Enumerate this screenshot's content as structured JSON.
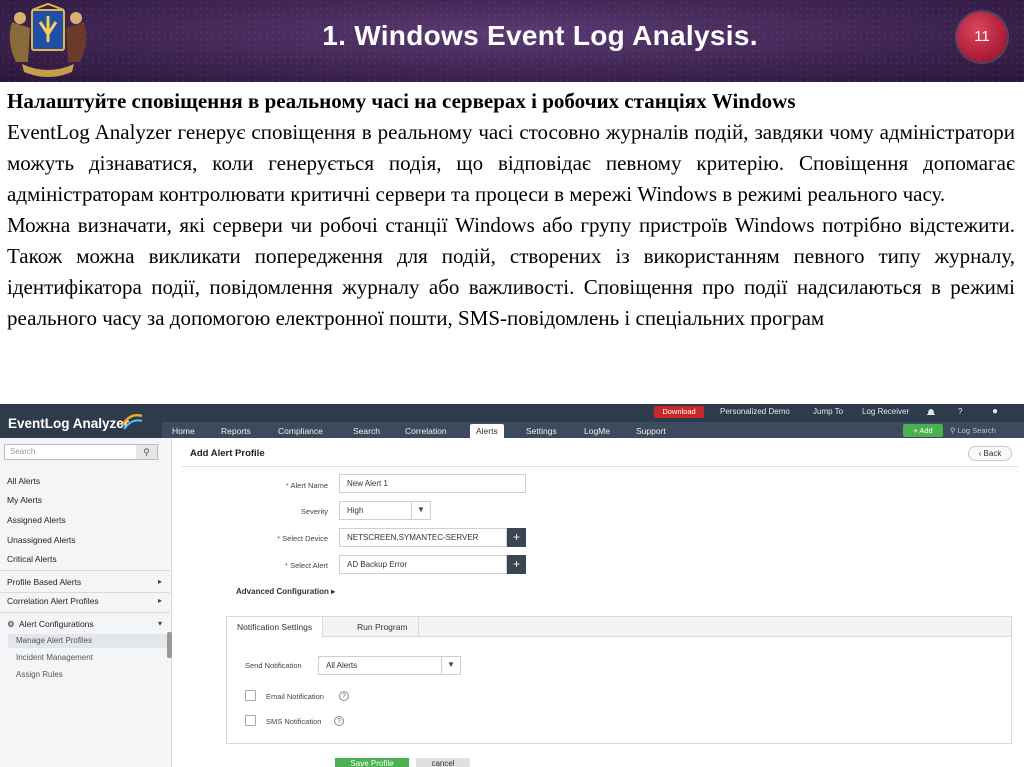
{
  "slide": {
    "title": "1. Windows Event Log Analysis.",
    "number": "11",
    "heading": "Налаштуйте сповіщення в реальному часі на серверах і робочих станціях Windows",
    "paragraph1": "EventLog Analyzer генерує сповіщення в реальному часі стосовно журналів подій, завдяки чому адміністратори можуть дізнаватися, коли генерується подія, що відповідає певному критерію. Сповіщення допомагає адміністраторам контролювати критичні сервери та процеси в мережі Windows в режимі реального часу.",
    "paragraph2": "Можна визначати, які сервери чи робочі станції Windows або групу пристроїв Windows потрібно відстежити. Також можна викликати попередження для подій, створених із використанням певного типу журналу, ідентифікатора події, повідомлення журналу або важливості. Сповіщення про події надсилаються в режимі реального часу за допомогою електронної пошти, SMS-повідомлень і спеціальних програм"
  },
  "app": {
    "logo": "EventLog Analyzer",
    "utility": {
      "download": "Download",
      "personalized_demo": "Personalized Demo",
      "jump_to": "Jump To",
      "log_receiver": "Log Receiver",
      "help": "?",
      "user": "●"
    },
    "nav": [
      "Home",
      "Reports",
      "Compliance",
      "Search",
      "Correlation",
      "Alerts",
      "Settings",
      "LogMe",
      "Support"
    ],
    "add_button": "+ Add",
    "top_search": "Log Search",
    "sidebar": {
      "search_placeholder": "Search",
      "items": [
        "All Alerts",
        "My Alerts",
        "Assigned Alerts",
        "Unassigned Alerts",
        "Critical Alerts"
      ],
      "groups": [
        "Profile Based Alerts",
        "Correlation Alert Profiles",
        "Alert Configurations"
      ],
      "sub_items": [
        "Manage Alert Profiles",
        "Incident Management",
        "Assign Rules"
      ]
    },
    "main": {
      "title": "Add Alert Profile",
      "back": "Back",
      "fields": {
        "alert_name_label": "Alert Name",
        "alert_name_value": "New Alert 1",
        "severity_label": "Severity",
        "severity_value": "High",
        "device_label": "Select Device",
        "device_value": "NETSCREEN,SYMANTEC-SERVER",
        "alert_label": "Select Alert",
        "alert_value": "AD Backup Error"
      },
      "advanced": "Advanced Configuration",
      "tabs": [
        "Notification Settings",
        "Run Program"
      ],
      "send_notification_label": "Send Notification",
      "send_notification_value": "All Alerts",
      "email_notification": "Email Notification",
      "sms_notification": "SMS Notification",
      "save": "Save Profile",
      "cancel": "cancel"
    }
  },
  "colors": {
    "header_bg": "#3d2350",
    "slide_number_bg": "#b0203a",
    "app_topbar": "#2e3b4b",
    "accent_green": "#4caf50",
    "download_red": "#c62828"
  }
}
